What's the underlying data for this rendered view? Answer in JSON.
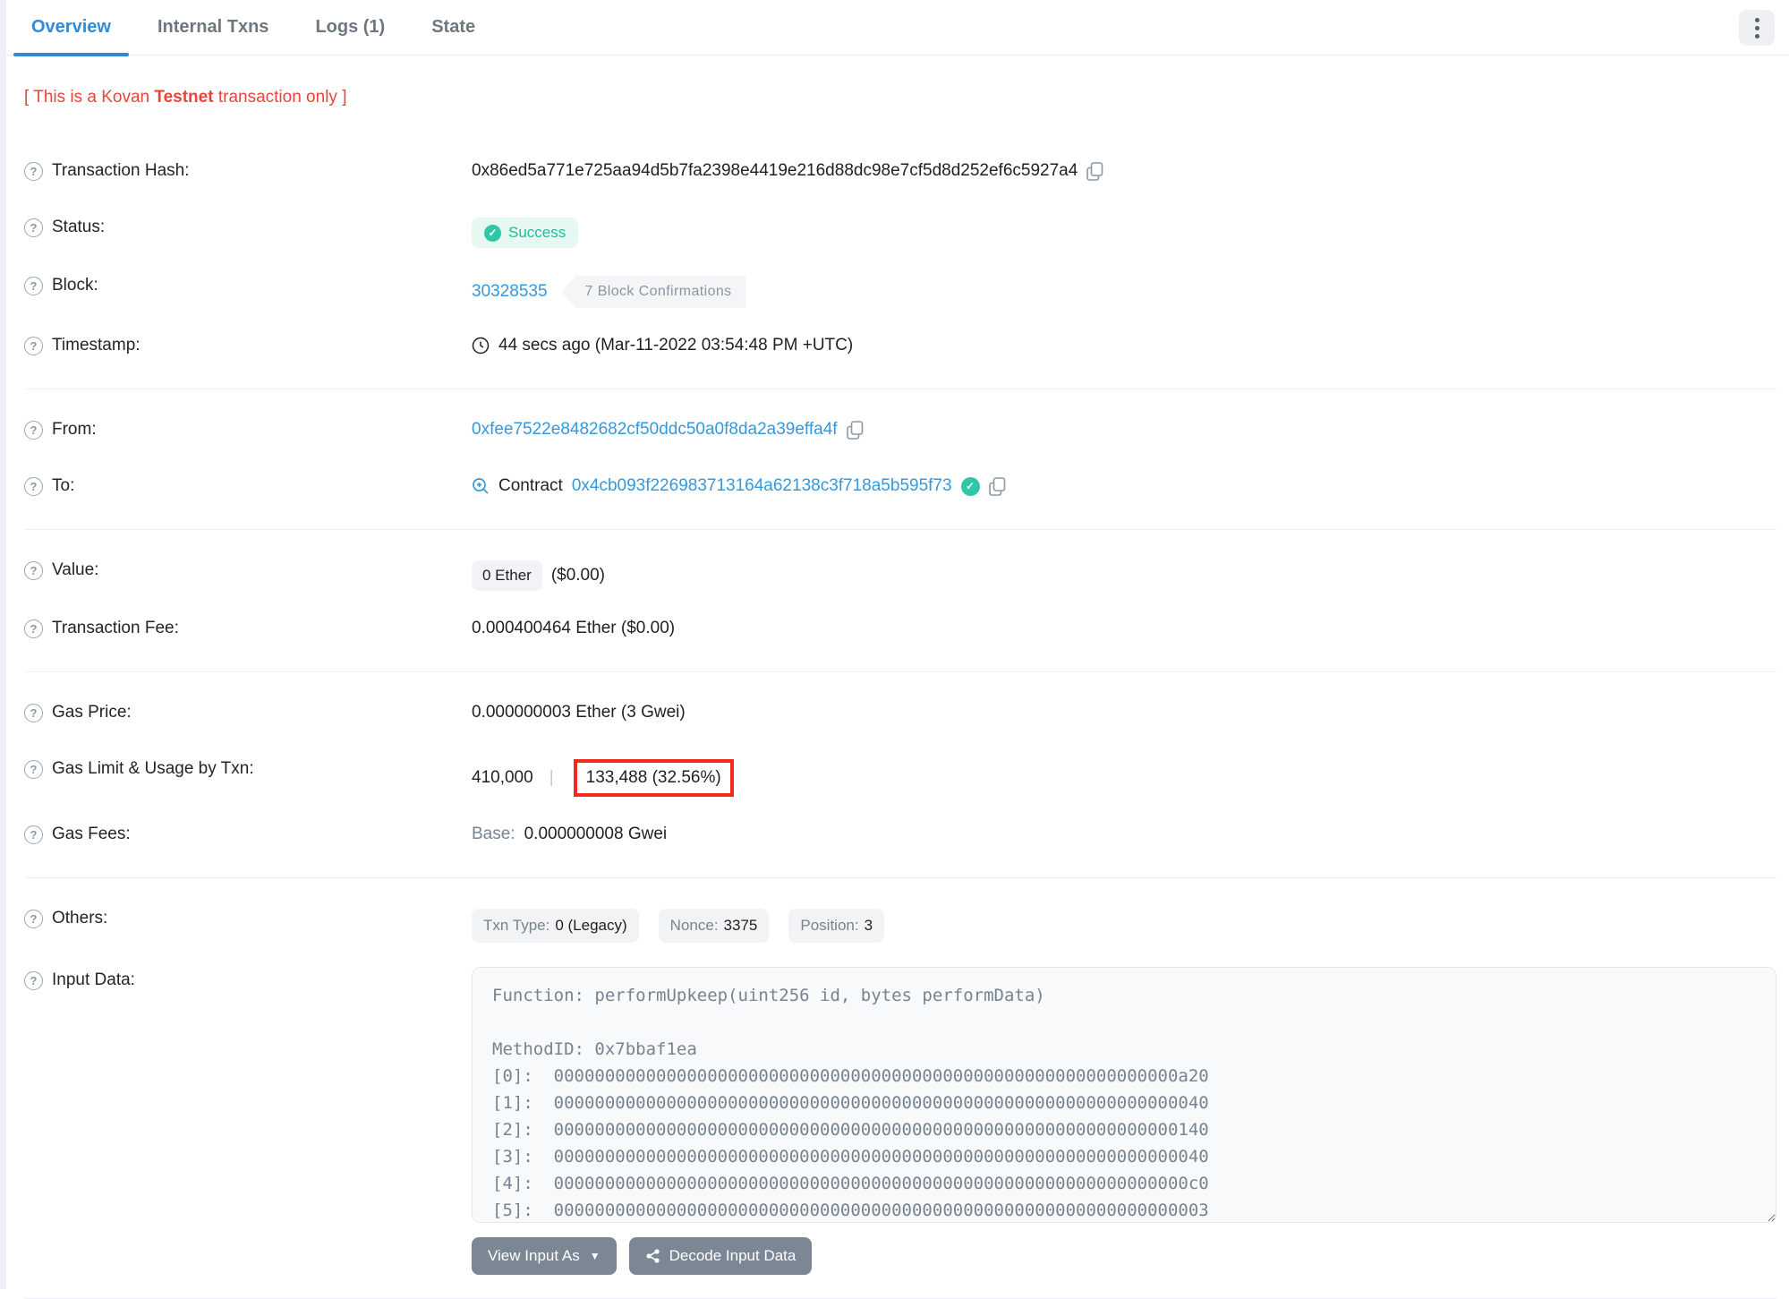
{
  "tabs": {
    "items": [
      {
        "label": "Overview",
        "active": true
      },
      {
        "label": "Internal Txns",
        "active": false
      },
      {
        "label": "Logs (1)",
        "active": false
      },
      {
        "label": "State",
        "active": false
      }
    ]
  },
  "notice": {
    "prefix": "[ This is a Kovan ",
    "bold": "Testnet",
    "suffix": " transaction only ]"
  },
  "rows": {
    "transaction_hash": {
      "label": "Transaction Hash:",
      "value": "0x86ed5a771e725aa94d5b7fa2398e4419e216d88dc98e7cf5d8d252ef6c5927a4"
    },
    "status": {
      "label": "Status:",
      "value": "Success",
      "check": "✓"
    },
    "block": {
      "label": "Block:",
      "number": "30328535",
      "confirmations": "7 Block Confirmations"
    },
    "timestamp": {
      "label": "Timestamp:",
      "value": "44 secs ago (Mar-11-2022 03:54:48 PM +UTC)"
    },
    "from": {
      "label": "From:",
      "address": "0xfee7522e8482682cf50ddc50a0f8da2a39effa4f"
    },
    "to": {
      "label": "To:",
      "prefix": "Contract",
      "address": "0x4cb093f226983713164a62138c3f718a5b595f73",
      "check": "✓"
    },
    "value": {
      "label": "Value:",
      "badge": "0 Ether",
      "usd": "($0.00)"
    },
    "transaction_fee": {
      "label": "Transaction Fee:",
      "value": "0.000400464 Ether ($0.00)"
    },
    "gas_price": {
      "label": "Gas Price:",
      "value": "0.000000003 Ether (3 Gwei)"
    },
    "gas_limit": {
      "label": "Gas Limit & Usage by Txn:",
      "limit": "410,000",
      "separator": "|",
      "usage": "133,488 (32.56%)"
    },
    "gas_fees": {
      "label": "Gas Fees:",
      "base_label": "Base:",
      "base_value": "0.000000008 Gwei"
    },
    "others": {
      "label": "Others:",
      "badges": [
        {
          "k": "Txn Type:",
          "v": "0 (Legacy)"
        },
        {
          "k": "Nonce:",
          "v": "3375"
        },
        {
          "k": "Position:",
          "v": "3"
        }
      ]
    },
    "input_data": {
      "label": "Input Data:",
      "content": "Function: performUpkeep(uint256 id, bytes performData)\n\nMethodID: 0x7bbaf1ea\n[0]:  0000000000000000000000000000000000000000000000000000000000000a20\n[1]:  0000000000000000000000000000000000000000000000000000000000000040\n[2]:  0000000000000000000000000000000000000000000000000000000000000140\n[3]:  0000000000000000000000000000000000000000000000000000000000000040\n[4]:  00000000000000000000000000000000000000000000000000000000000000c0\n[5]:  0000000000000000000000000000000000000000000000000000000000000003"
    }
  },
  "buttons": {
    "view_input_as": "View Input As",
    "decode_input_data": "Decode Input Data"
  },
  "colors": {
    "link_blue": "#3498db",
    "active_tab_blue": "#2f8ad8",
    "success_teal": "#2fc7a6",
    "success_bg": "#e7f8f3",
    "danger_red": "#e8453a",
    "annotation_red": "#f5281b",
    "muted_gray": "#77838f",
    "button_slate": "#7b8794"
  }
}
